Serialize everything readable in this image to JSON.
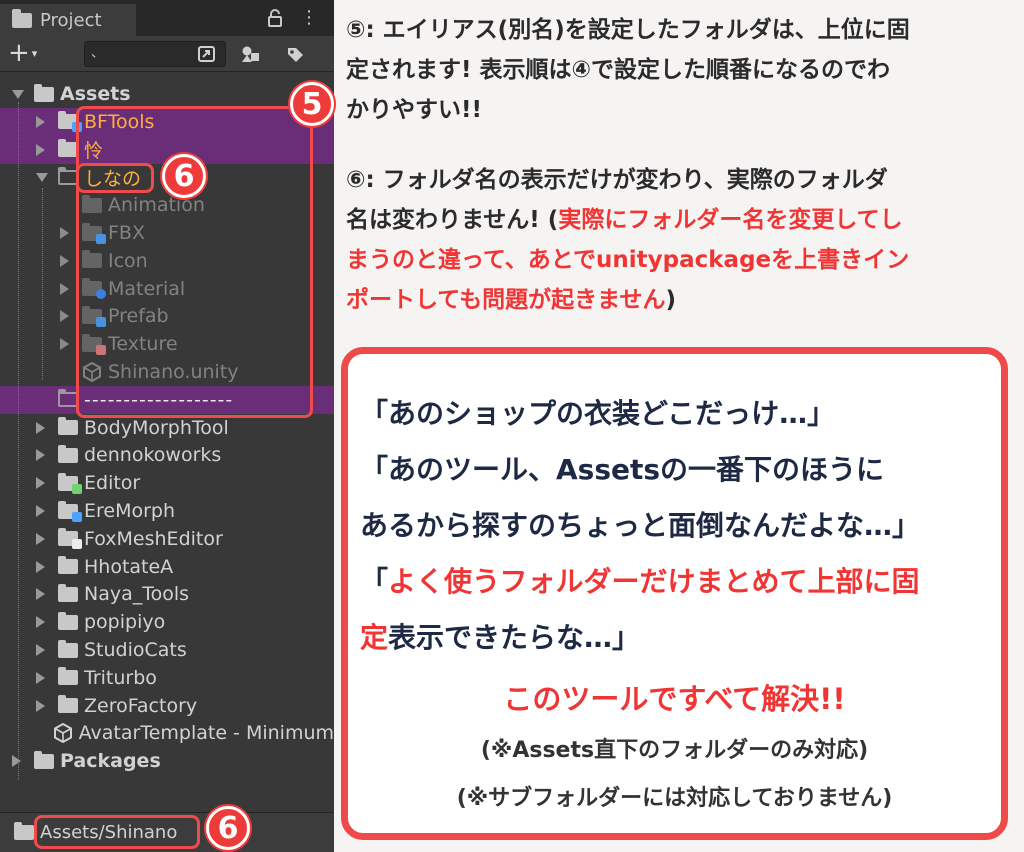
{
  "panel": {
    "tab_title": "Project",
    "menu_glyph": "⋮",
    "add_glyph": "+",
    "add_caret": "▾",
    "search_value": "、",
    "footer_path": "Assets/Shinano"
  },
  "tree": [
    {
      "label": "Assets",
      "depth": 0,
      "arrow": "down",
      "icon": "folder",
      "bold": true
    },
    {
      "label": "BFTools",
      "depth": 1,
      "arrow": "right",
      "icon": "folder-badge-blue",
      "alias": true,
      "highlight": true
    },
    {
      "label": "怜",
      "depth": 1,
      "arrow": "right",
      "icon": "folder",
      "alias": true,
      "highlight": true
    },
    {
      "label": "しなの",
      "depth": 1,
      "arrow": "down",
      "icon": "folder-empty",
      "alias": true,
      "highlight": false
    },
    {
      "label": "Animation",
      "depth": 2,
      "arrow": "",
      "icon": "folder-dim",
      "dim": true
    },
    {
      "label": "FBX",
      "depth": 2,
      "arrow": "right",
      "icon": "folder-badge-blue-dim",
      "dim": true
    },
    {
      "label": "Icon",
      "depth": 2,
      "arrow": "right",
      "icon": "folder-dim",
      "dim": true
    },
    {
      "label": "Material",
      "depth": 2,
      "arrow": "right",
      "icon": "folder-badge-round-dim",
      "dim": true
    },
    {
      "label": "Prefab",
      "depth": 2,
      "arrow": "right",
      "icon": "folder-badge-blue-dim",
      "dim": true
    },
    {
      "label": "Texture",
      "depth": 2,
      "arrow": "right",
      "icon": "folder-badge-red-dim",
      "dim": true
    },
    {
      "label": "Shinano.unity",
      "depth": 2,
      "arrow": "",
      "icon": "unity",
      "dim": true
    },
    {
      "label": "-------------------",
      "depth": 1,
      "arrow": "",
      "icon": "folder-empty",
      "highlight": true,
      "dash": true
    },
    {
      "label": "BodyMorphTool",
      "depth": 1,
      "arrow": "right",
      "icon": "folder"
    },
    {
      "label": "dennokoworks",
      "depth": 1,
      "arrow": "right",
      "icon": "folder"
    },
    {
      "label": "Editor",
      "depth": 1,
      "arrow": "right",
      "icon": "folder-badge-green"
    },
    {
      "label": "EreMorph",
      "depth": 1,
      "arrow": "right",
      "icon": "folder-badge-blue"
    },
    {
      "label": "FoxMeshEditor",
      "depth": 1,
      "arrow": "right",
      "icon": "folder-badge-white"
    },
    {
      "label": "HhotateA",
      "depth": 1,
      "arrow": "right",
      "icon": "folder"
    },
    {
      "label": "Naya_Tools",
      "depth": 1,
      "arrow": "right",
      "icon": "folder"
    },
    {
      "label": "popipiyo",
      "depth": 1,
      "arrow": "right",
      "icon": "folder"
    },
    {
      "label": "StudioCats",
      "depth": 1,
      "arrow": "right",
      "icon": "folder"
    },
    {
      "label": "Triturbo",
      "depth": 1,
      "arrow": "right",
      "icon": "folder"
    },
    {
      "label": "ZeroFactory",
      "depth": 1,
      "arrow": "right",
      "icon": "folder"
    },
    {
      "label": "AvatarTemplate - Minimum",
      "depth": 1,
      "arrow": "",
      "icon": "unity"
    },
    {
      "label": "Packages",
      "depth": 0,
      "arrow": "right",
      "icon": "folder",
      "bold": true
    }
  ],
  "badges": {
    "b5": "5",
    "b6a": "6",
    "b6b": "6"
  },
  "note5": {
    "l1_prefix": "⑤: エイリアス(別名)を設定したフォルダは、上位に固",
    "l2": "定されます! 表示順は④で設定した順番になるのでわ",
    "l3": "かりやすい!!"
  },
  "note6": {
    "l1": "⑥: フォルダ名の表示だけが変わり、実際のフォルダ",
    "l2_black": "名は変わりません! (",
    "l2_red": "実際にフォルダー名を変更してし",
    "l3_red": "まうのと違って、あとでunitypackageを上書きイン",
    "l4_red": "ポートしても問題が起きません",
    "l4_black": ")"
  },
  "callout": {
    "q1": "「あのショップの衣装どこだっけ…」",
    "q2": "「あのツール、Assetsの一番下のほうに",
    "q3": "あるから探すのちょっと面倒なんだよな…」",
    "q4_open": "「",
    "q4_red": "よく使うフォルダーだけまとめて上部に固",
    "q5_red": "定",
    "q5_black": "表示できたらな…」",
    "solve": "このツールですべて解決!!",
    "foot1": "(※Assets直下のフォルダーのみ対応)",
    "foot2": "(※サブフォルダーには対応しておりません)"
  },
  "colors": {
    "panel_bg": "#383838",
    "highlight_purple": "#6a2e78",
    "alias_orange": "#ffaf3a",
    "accent_red": "#ef4b4b",
    "text_dark": "#2b2b2b"
  }
}
